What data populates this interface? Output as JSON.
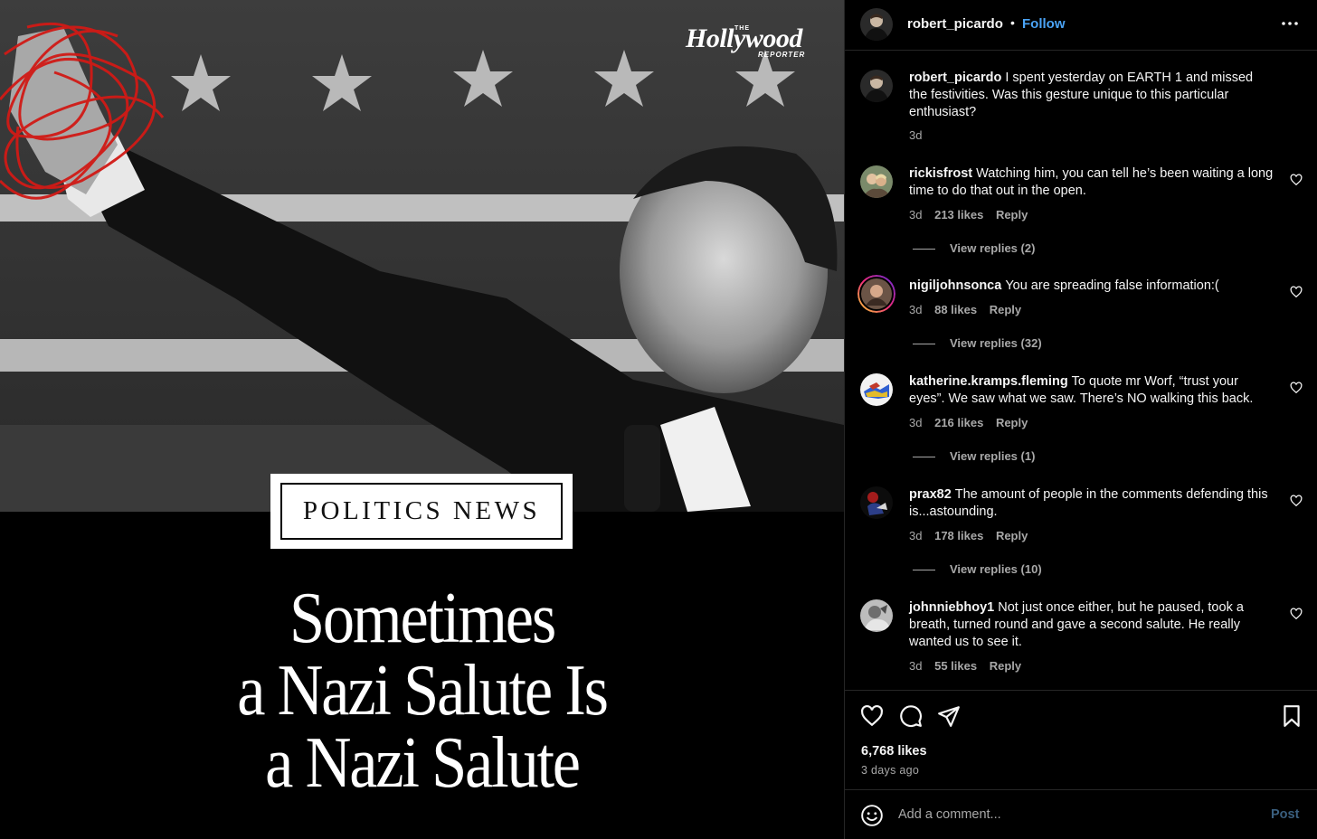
{
  "image": {
    "masthead": {
      "the": "THE",
      "word": "Hollywood",
      "reporter": "REPORTER"
    },
    "category": "POLITICS NEWS",
    "headline": [
      "Sometimes",
      "a Nazi Salute Is",
      "a Nazi Salute"
    ],
    "scribble_color": "#d11a16"
  },
  "header": {
    "username": "robert_picardo",
    "separator": "•",
    "follow_label": "Follow",
    "more_icon": "more-horizontal-icon"
  },
  "comments": [
    {
      "username": "robert_picardo",
      "text": "I spent yesterday on EARTH 1 and missed the festivities. Was this gesture unique to this particular enthusiast?",
      "time": "3d",
      "caption": true
    },
    {
      "username": "rickisfrost",
      "text": "Watching him, you can tell he’s been waiting a long time to do that out in the open.",
      "time": "3d",
      "likes": "213 likes",
      "reply": "Reply",
      "view_replies": "View replies (2)"
    },
    {
      "username": "nigiljohnsonca",
      "text": "You are spreading false information:(",
      "time": "3d",
      "likes": "88 likes",
      "reply": "Reply",
      "view_replies": "View replies (32)"
    },
    {
      "username": "katherine.kramps.fleming",
      "text": "To quote mr Worf, “trust your eyes”. We saw what we saw. There’s NO walking this back.",
      "time": "3d",
      "likes": "216 likes",
      "reply": "Reply",
      "view_replies": "View replies (1)"
    },
    {
      "username": "prax82",
      "text": "The amount of people in the comments defending this is...astounding.",
      "time": "3d",
      "likes": "178 likes",
      "reply": "Reply",
      "view_replies": "View replies (10)"
    },
    {
      "username": "johnniebhoy1",
      "text": "Not just once either, but he paused, took a breath, turned round and gave a second salute. He really wanted us to see it.",
      "time": "3d",
      "likes": "55 likes",
      "reply": "Reply"
    }
  ],
  "actions": {
    "icons": [
      "heart-icon",
      "comment-icon",
      "share-icon",
      "bookmark-icon"
    ],
    "likes": "6,768 likes",
    "posted": "3 days ago"
  },
  "add_comment": {
    "placeholder": "Add a comment...",
    "post_label": "Post",
    "emoji_icon": "emoji-icon"
  },
  "colors": {
    "link_blue": "#4aa3f5",
    "muted": "#a8a8a8",
    "post_disabled": "#3a5f7f",
    "divider": "#262626"
  }
}
